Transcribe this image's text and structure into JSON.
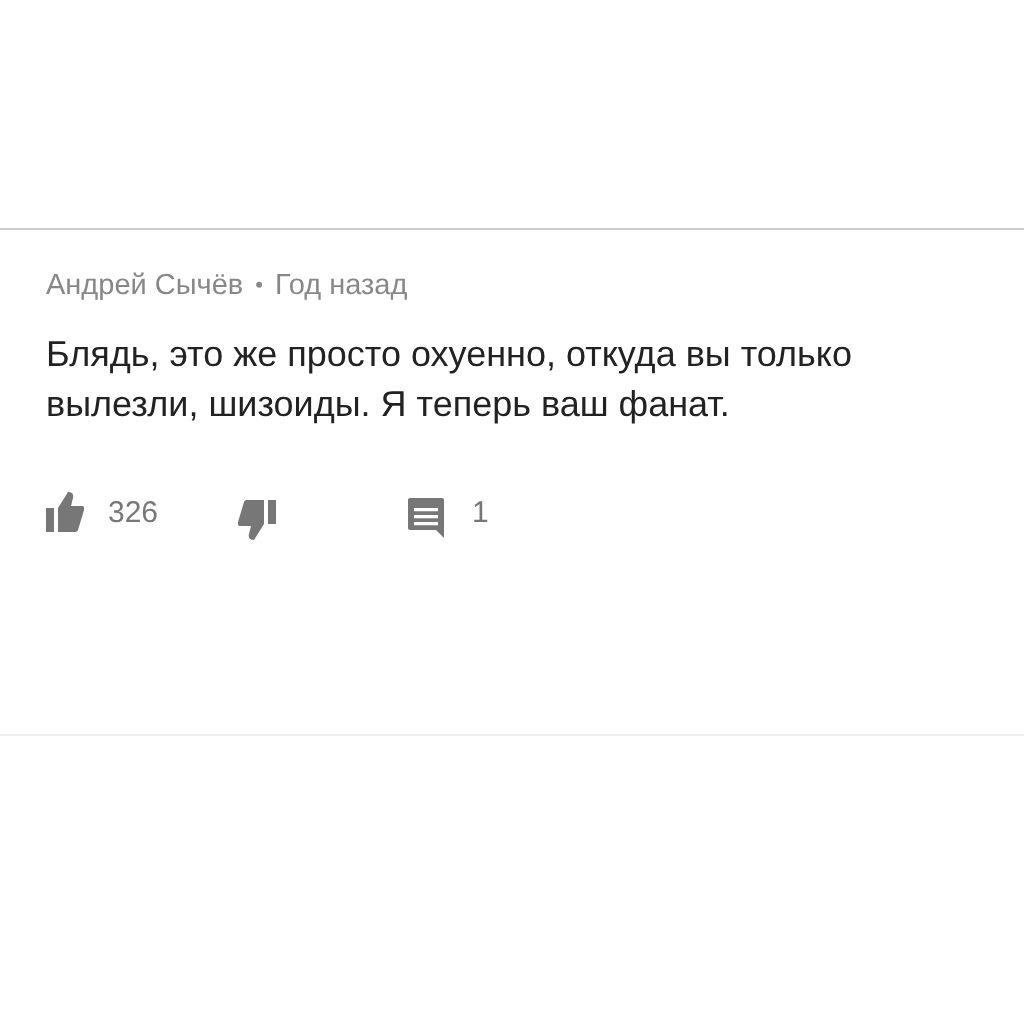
{
  "comment": {
    "author": "Андрей Сычёв",
    "separator": "•",
    "time": "Год назад",
    "text": "Блядь, это же просто охуенно, откуда вы только вылезли, шизоиды. Я теперь ваш фанат.",
    "likes": "326",
    "replies": "1"
  }
}
